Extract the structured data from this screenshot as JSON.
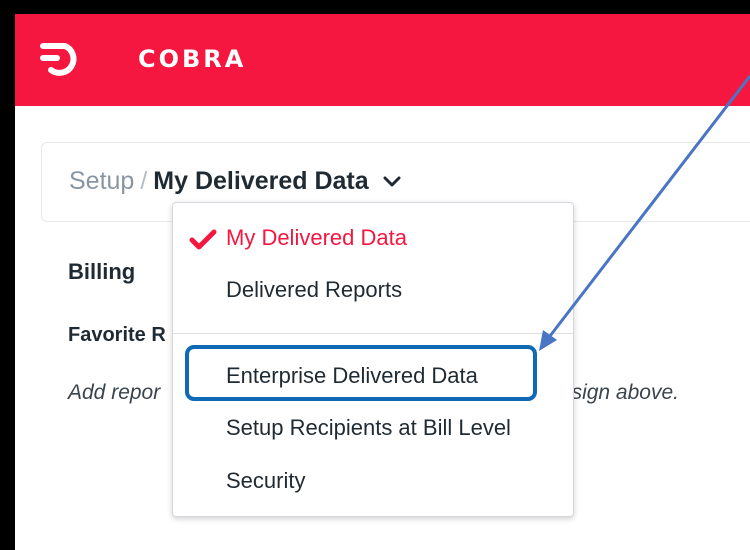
{
  "header": {
    "app_name": "COBRA",
    "logo_icon": "cobra-logo-icon",
    "background_color": "#f5173f"
  },
  "breadcrumb": {
    "parent": "Setup",
    "separator": "/",
    "current": "My Delivered Data",
    "chevron_icon": "chevron-down-icon"
  },
  "content": {
    "section_heading": "Billing",
    "favorite_label": "Favorite R",
    "hint_left": "Add repor",
    "hint_right": "s sign above."
  },
  "dropdown": {
    "items": [
      {
        "label": "My Delivered Data",
        "selected": true,
        "icon": "checkmark-icon"
      },
      {
        "label": "Delivered Reports",
        "selected": false
      },
      {
        "label": "Enterprise Delivered Data",
        "selected": false,
        "highlighted": true
      },
      {
        "label": "Setup Recipients at Bill Level",
        "selected": false
      },
      {
        "label": "Security",
        "selected": false
      }
    ]
  },
  "annotation": {
    "highlight_color": "#0f69b4",
    "arrow_color": "#4a74c4"
  }
}
